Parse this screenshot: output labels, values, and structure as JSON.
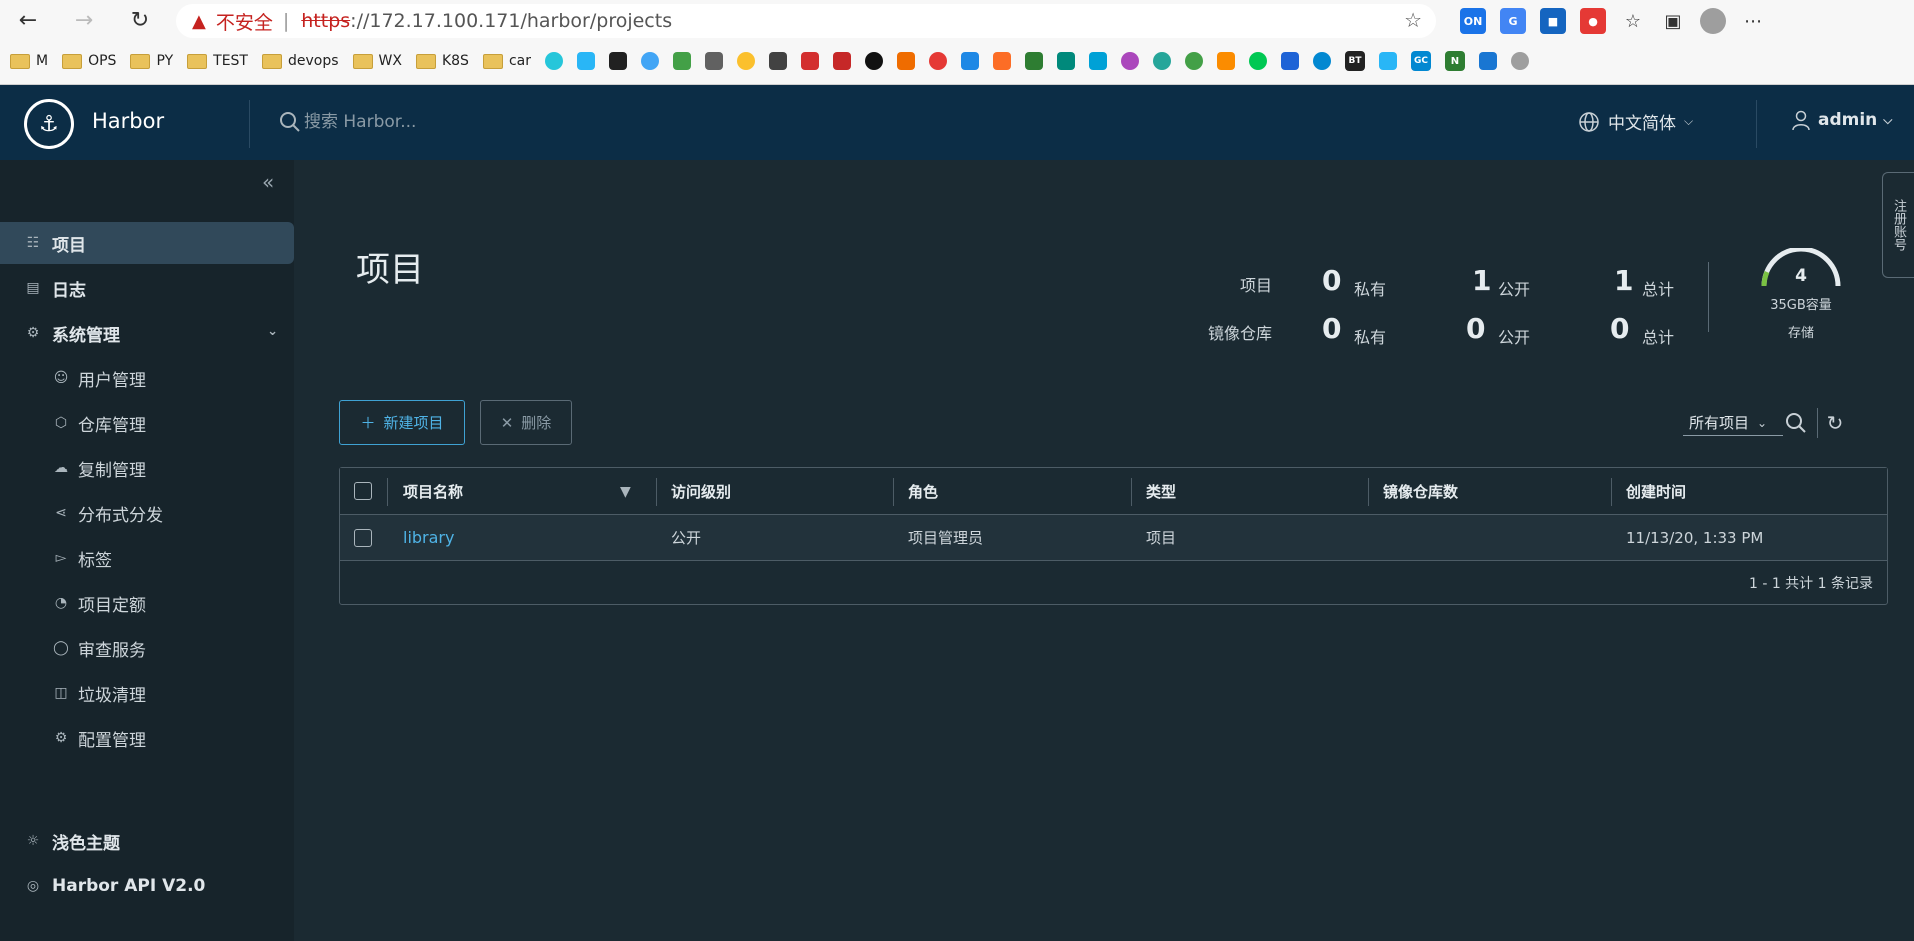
{
  "browser": {
    "insecure_label": "不安全",
    "url_scheme": "https",
    "url_rest": "://172.17.100.171/harbor/projects",
    "bookmarks": [
      {
        "label": "M"
      },
      {
        "label": "OPS"
      },
      {
        "label": "PY"
      },
      {
        "label": "TEST"
      },
      {
        "label": "devops"
      },
      {
        "label": "WX"
      },
      {
        "label": "K8S"
      },
      {
        "label": "car"
      }
    ],
    "ext_on_label": "ON",
    "ext_bt_label": "BT",
    "ext_gc_label": "GC",
    "ext_n_label": "N"
  },
  "header": {
    "brand": "Harbor",
    "search_placeholder": "搜索 Harbor...",
    "language": "中文简体",
    "user": "admin"
  },
  "sidebar": {
    "projects": "项目",
    "logs": "日志",
    "admin": "系统管理",
    "sub": {
      "users": "用户管理",
      "registries": "仓库管理",
      "replications": "复制管理",
      "distributions": "分布式分发",
      "labels": "标签",
      "quotas": "项目定额",
      "interrogation": "审查服务",
      "gc": "垃圾清理",
      "config": "配置管理"
    },
    "theme": "浅色主题",
    "api": "Harbor API V2.0"
  },
  "feedback_tab": "注册账号",
  "main": {
    "title": "项目",
    "stats": {
      "row1_label": "项目",
      "row2_label": "镜像仓库",
      "private_label": "私有",
      "public_label": "公开",
      "total_label": "总计",
      "projects_private": "0",
      "projects_public": "1",
      "projects_total": "1",
      "repos_private": "0",
      "repos_public": "0",
      "repos_total": "0"
    },
    "storage": {
      "count": "4",
      "capacity": "35GB容量",
      "label": "存储"
    },
    "new_project_button": "新建项目",
    "delete_button": "删除",
    "filter_value": "所有项目",
    "columns": [
      "项目名称",
      "访问级别",
      "角色",
      "类型",
      "镜像仓库数",
      "创建时间"
    ],
    "rows": [
      {
        "name": "library",
        "access": "公开",
        "role": "项目管理员",
        "type": "项目",
        "repo_count": "",
        "created": "11/13/20, 1:33 PM"
      }
    ],
    "footer": "1 - 1 共计 1 条记录"
  },
  "colors": {
    "header_bg": "#0c2d46",
    "sidebar_bg": "#17242b",
    "content_bg": "#1b2a32",
    "accent": "#4fb3e6"
  }
}
